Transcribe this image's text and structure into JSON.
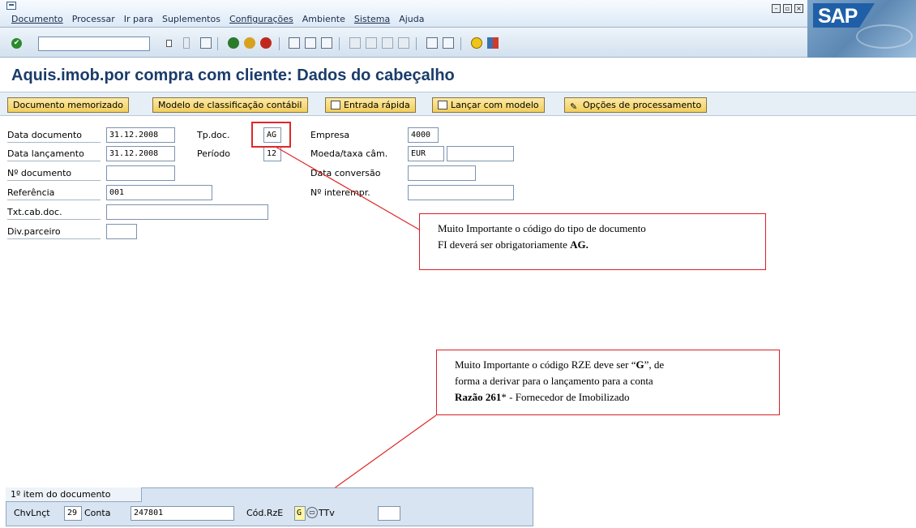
{
  "menu": {
    "items": [
      "Documento",
      "Processar",
      "Ir para",
      "Suplementos",
      "Configurações",
      "Ambiente",
      "Sistema",
      "Ajuda"
    ]
  },
  "logo": "SAP",
  "page_title": "Aquis.imob.por compra com cliente: Dados do cabeçalho",
  "app_toolbar": {
    "btn1": "Documento memorizado",
    "btn2": "Modelo de classificação contábil",
    "btn3": "Entrada rápida",
    "btn4": "Lançar com modelo",
    "btn5": "Opções de processamento"
  },
  "form": {
    "data_documento_label": "Data documento",
    "data_documento": "31.12.2008",
    "data_lancamento_label": "Data lançamento",
    "data_lancamento": "31.12.2008",
    "n_documento_label": "Nº documento",
    "referencia_label": "Referência",
    "referencia": "001",
    "txt_cab_label": "Txt.cab.doc.",
    "div_parceiro_label": "Div.parceiro",
    "tp_doc_label": "Tp.doc.",
    "tp_doc": "AG",
    "periodo_label": "Período",
    "periodo": "12",
    "empresa_label": "Empresa",
    "empresa": "4000",
    "moeda_label": "Moeda/taxa câm.",
    "moeda": "EUR",
    "data_conversao_label": "Data conversão",
    "n_interempr_label": "Nº interempr."
  },
  "callout1": {
    "line1": "Muito Importante o código do tipo de documento",
    "line2": "FI deverá ser obrigatoriamente ",
    "bold": "AG."
  },
  "callout2": {
    "line1a": "Muito Importante o código RZE deve ser “",
    "bold1": "G",
    "line1b": "”, de",
    "line2": "forma a derivar para o lançamento para a conta",
    "bold2": "Razão 261",
    "line3": "* - Fornecedor de Imobilizado"
  },
  "item": {
    "tab_label": "1º item do documento",
    "chvlnct_label": "ChvLnçt",
    "chvlnct": "29",
    "conta_label": "Conta",
    "conta": "247801",
    "codrze_label": "Cód.RzE",
    "codrze": "G",
    "tv_label": "TTv"
  }
}
